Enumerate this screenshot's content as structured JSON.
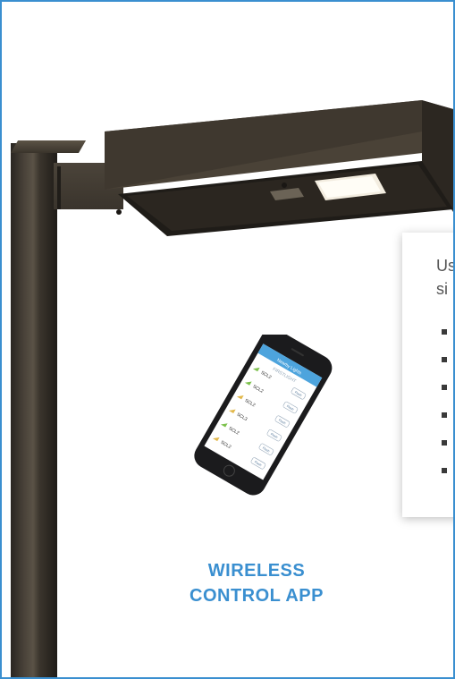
{
  "caption": {
    "line1": "WIRELESS",
    "line2": "CONTROL APP"
  },
  "card": {
    "line1": "Us",
    "line2": "si",
    "bullet_count": 6
  },
  "app": {
    "title": "Nearby Lights",
    "brand": "FIRSTLIGHT",
    "rows": [
      {
        "name": "SCL2",
        "button": "Flash"
      },
      {
        "name": "SCL2",
        "button": "Flash"
      },
      {
        "name": "SCL2",
        "button": "Flash"
      },
      {
        "name": "SCL3",
        "button": "Flash"
      },
      {
        "name": "SCL2",
        "button": "Flash"
      },
      {
        "name": "SCL2",
        "button": "Flash"
      }
    ]
  },
  "colors": {
    "border": "#3a8fd0",
    "caption": "#3a8fd0",
    "fixture": "#4a4237"
  }
}
